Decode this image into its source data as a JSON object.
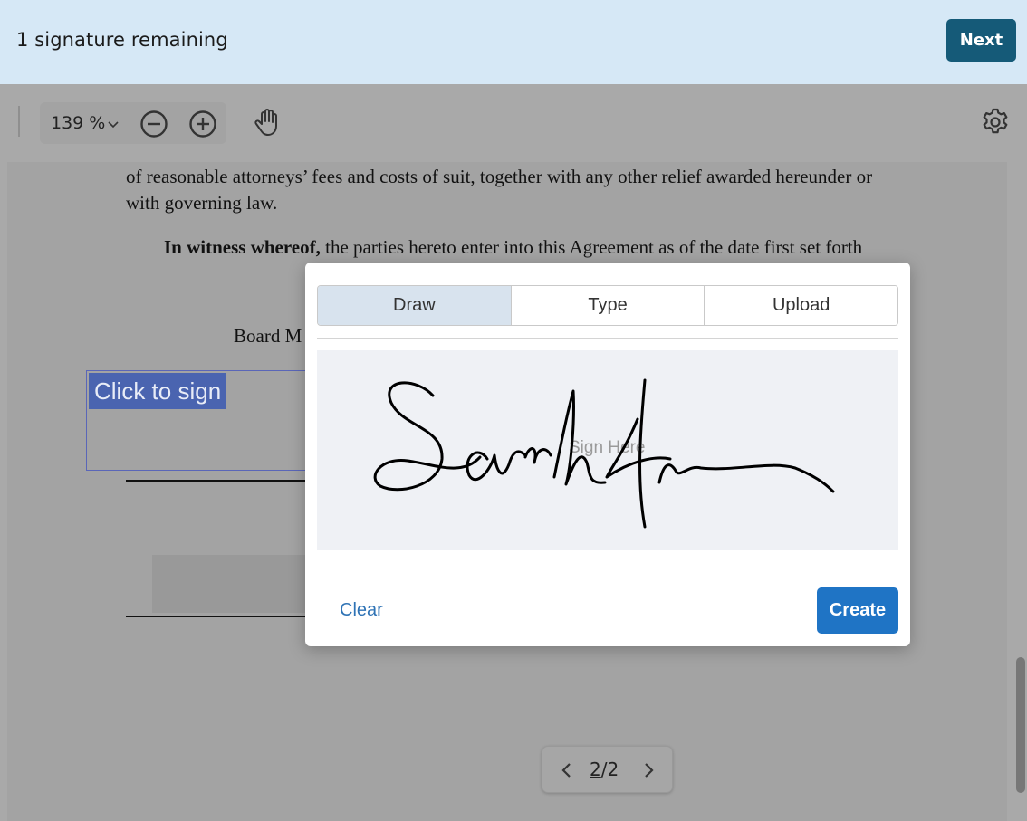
{
  "banner": {
    "status_text": "1 signature remaining",
    "next_label": "Next"
  },
  "toolbar": {
    "zoom_value": "139 %",
    "icons": [
      "chevron-down-icon",
      "zoom-out-icon",
      "zoom-in-icon",
      "hand-pan-icon",
      "gear-icon"
    ]
  },
  "document": {
    "line1": "of reasonable attorneys’ fees and costs of suit, together with any other relief awarded hereunder or",
    "line2": "with governing law.",
    "witness_bold": "In witness whereof,",
    "witness_rest": " the parties hereto enter into this Agreement as of the date first set forth",
    "board_label": "Board M",
    "sign_tag": "Click to sign"
  },
  "pagination": {
    "current": "2",
    "separator": "/",
    "total": "2"
  },
  "modal": {
    "tabs": [
      "Draw",
      "Type",
      "Upload"
    ],
    "active_tab": "Draw",
    "placeholder": "Sign Here",
    "clear_label": "Clear",
    "create_label": "Create"
  },
  "colors": {
    "banner_bg": "#d6e8f6",
    "next_button": "#155a78",
    "create_button": "#1f74c5",
    "link": "#2f73b5",
    "sign_tag_bg": "#4a64b0"
  }
}
